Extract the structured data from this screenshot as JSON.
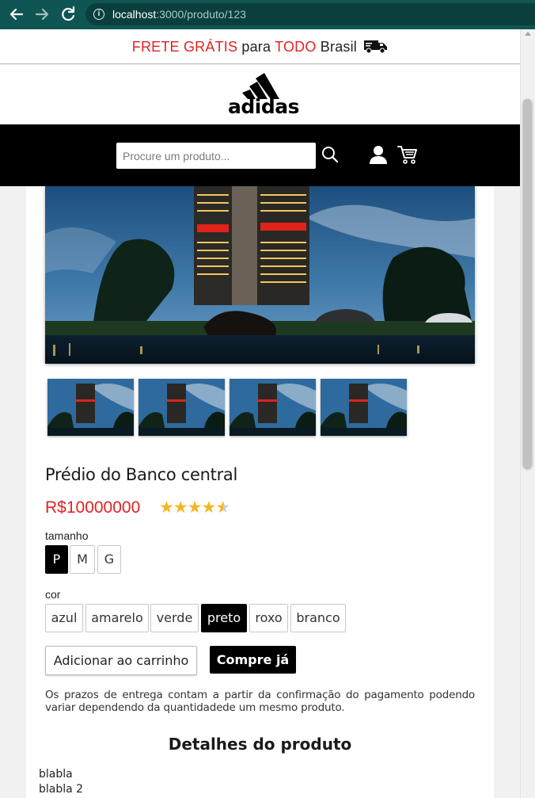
{
  "browser": {
    "url_host": "localhost",
    "url_rest": ":3000/produto/123"
  },
  "banner": {
    "part1": "FRETE GRÁTIS",
    "part2": "para",
    "part3": "TODO",
    "part4": "Brasil",
    "icon": "truck-icon"
  },
  "header": {
    "logo_text": "adidas",
    "search_placeholder": "Procure um produto...",
    "icons": [
      "search-icon",
      "user-icon",
      "cart-icon"
    ]
  },
  "product": {
    "title": "Prédio do Banco central",
    "price": "R$10000000",
    "rating": 4.5,
    "rating_max": 5,
    "size_label": "tamanho",
    "sizes": [
      "P",
      "M",
      "G"
    ],
    "selected_size": "P",
    "color_label": "cor",
    "colors": [
      "azul",
      "amarelo",
      "verde",
      "preto",
      "roxo",
      "branco"
    ],
    "selected_color": "preto",
    "add_to_cart": "Adicionar ao carrinho",
    "buy_now": "Compre já",
    "notice": "Os prazos de entrega contam a partir da confirmação do pagamento podendo variar dependendo da quantidadede um mesmo produto.",
    "thumbnail_count": 4
  },
  "details": {
    "title": "Detalhes do produto",
    "lines": [
      "blabla",
      "blabla 2"
    ]
  },
  "colors": {
    "accent_red": "#e32222",
    "star": "#f3b725",
    "chrome": "#0f5553"
  }
}
